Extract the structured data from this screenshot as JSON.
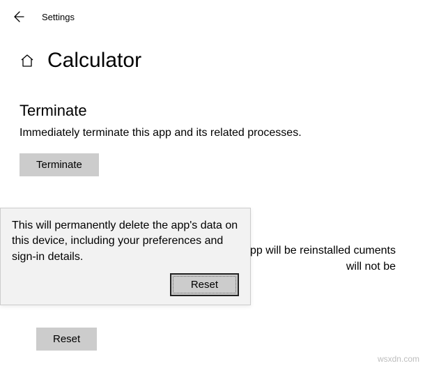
{
  "header": {
    "title": "Settings"
  },
  "app_title": "Calculator",
  "terminate": {
    "heading": "Terminate",
    "description": "Immediately terminate this app and its related processes.",
    "button_label": "Terminate"
  },
  "reset": {
    "description": "s app will be reinstalled cuments will not be",
    "button_label": "Reset"
  },
  "tooltip": {
    "text": "This will permanently delete the app's data on this device, including your preferences and sign-in details.",
    "button_label": "Reset"
  },
  "watermark": "wsxdn.com"
}
